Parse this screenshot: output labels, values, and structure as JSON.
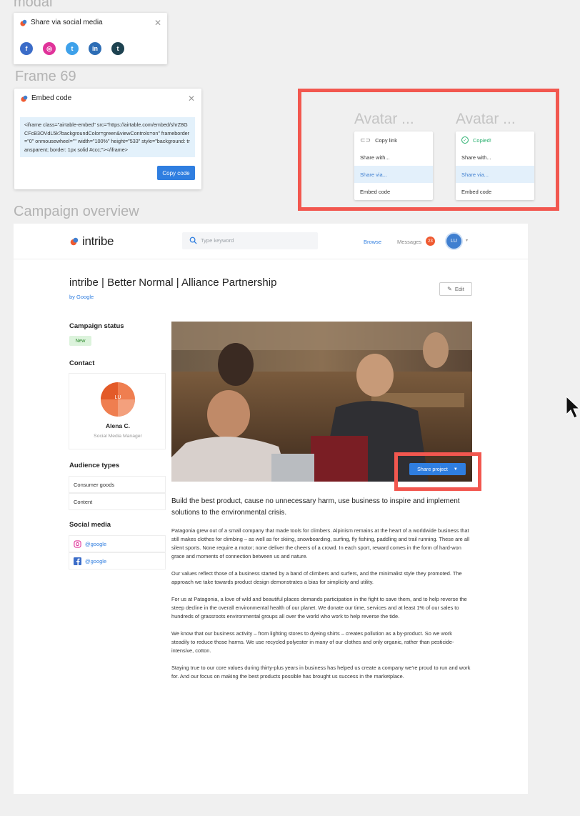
{
  "labels": {
    "modal": "modal",
    "frame69": "Frame 69",
    "campaign_overview": "Campaign overview"
  },
  "share_modal": {
    "title": "Share via social media",
    "close_icon": "close-icon",
    "networks": [
      {
        "name": "facebook",
        "glyph": "f",
        "color": "#3b6cc8"
      },
      {
        "name": "instagram",
        "glyph": "◎",
        "color": "#e0339a"
      },
      {
        "name": "twitter",
        "glyph": "t",
        "color": "#3ea1ea"
      },
      {
        "name": "linkedin",
        "glyph": "in",
        "color": "#2d6db5"
      },
      {
        "name": "tumblr",
        "glyph": "t",
        "color": "#1d4250"
      }
    ]
  },
  "embed_modal": {
    "title": "Embed code",
    "code": "<iframe class=\"airtable-embed\" src=\"https://airtable.com/embed/shrZ8GCFcB3OVdL5k?backgroundColor=green&viewControls=on\" frameborder=\"0\" onmousewheel=\"\" width=\"100%\" height=\"533\" style=\"background: transparent; border: 1px solid #ccc;\"></iframe>",
    "copy_button": "Copy code"
  },
  "avatar_menus": [
    {
      "title": "Avatar ...",
      "items": [
        {
          "label": "Copy link",
          "state": "normal",
          "icon": "link-icon"
        },
        {
          "label": "Share with...",
          "state": "normal"
        },
        {
          "label": "Share via...",
          "state": "active"
        },
        {
          "label": "Embed code",
          "state": "normal"
        }
      ]
    },
    {
      "title": "Avatar ...",
      "items": [
        {
          "label": "Copied!",
          "state": "copied",
          "icon": "check-circle-icon"
        },
        {
          "label": "Share with...",
          "state": "normal"
        },
        {
          "label": "Share via...",
          "state": "active"
        },
        {
          "label": "Embed code",
          "state": "normal"
        }
      ]
    }
  ],
  "topbar": {
    "brand": "intribe",
    "search_placeholder": "Type keyword",
    "browse": "Browse",
    "messages": "Messages",
    "messages_count": "23",
    "user_initials": "LU"
  },
  "campaign": {
    "title": "intribe | Better Normal | Alliance Partnership",
    "by": "by Google",
    "edit": "Edit",
    "status_heading": "Campaign status",
    "status": "New",
    "contact_heading": "Contact",
    "contact_initials": "LU",
    "contact_name": "Alena C.",
    "contact_role": "Social Media Manager",
    "audience_heading": "Audience types",
    "audience": [
      "Consumer goods",
      "Content"
    ],
    "social_heading": "Social media",
    "social": [
      {
        "network": "instagram",
        "handle": "@google"
      },
      {
        "network": "facebook",
        "handle": "@google"
      }
    ],
    "share_button": "Share project",
    "lead": "Build the best product, cause no unnecessary harm, use business to inspire and implement solutions to the environmental crisis.",
    "paragraphs": [
      "Patagonia grew out of a small company that made tools for climbers. Alpinism remains at the heart of a worldwide business that still makes clothes for climbing – as well as for skiing, snowboarding, surfing, fly fishing, paddling and trail running. These are all silent sports. None require a motor; none deliver the cheers of a crowd. In each sport, reward comes in the form of hard-won grace and moments of connection between us and nature.",
      "Our values reflect those of a business started by a band of climbers and surfers, and the minimalist style they promoted. The approach we take towards product design demonstrates a bias for simplicity and utility.",
      "For us at Patagonia, a love of wild and beautiful places demands participation in the fight to save them, and to help reverse the steep decline in the overall environmental health of our planet. We donate our time, services and at least 1% of our sales to hundreds of grassroots environmental groups all over the world who work to help reverse the tide.",
      "We know that our business activity – from lighting stores to dyeing shirts – creates pollution as a by-product. So we work steadily to reduce those harms. We use recycled polyester in many of our clothes and only organic, rather than pesticide-intensive, cotton.",
      "Staying true to our core values during thirty-plus years in business has helped us create a company we're proud to run and work for. And our focus on making the best products possible has brought us success in the marketplace."
    ]
  },
  "colors": {
    "accent": "#2f7ee0",
    "highlight_red": "#f2574f",
    "brand_orange": "#ef5a31"
  }
}
